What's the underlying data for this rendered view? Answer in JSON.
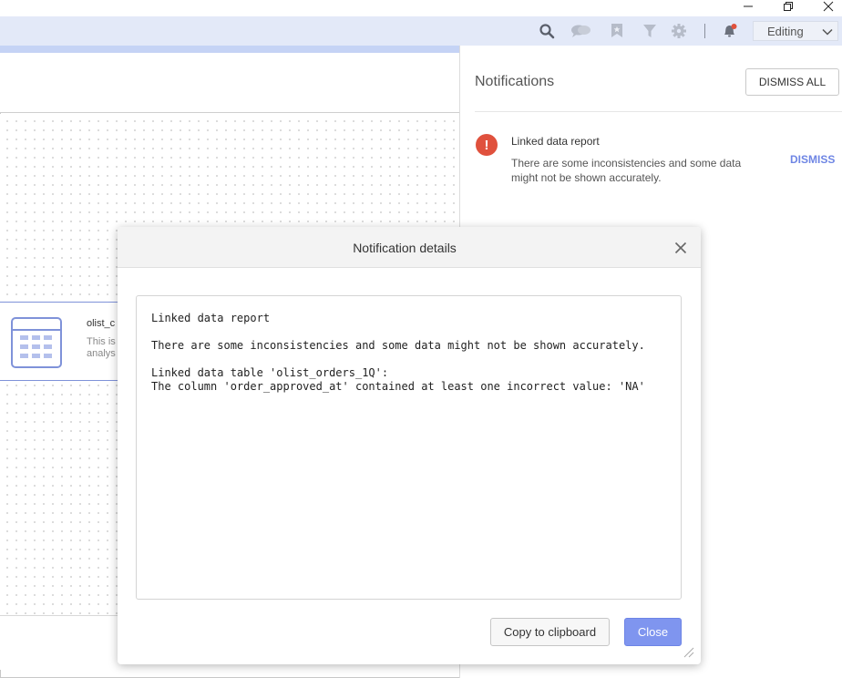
{
  "toolbar": {
    "mode_label": "Editing",
    "icons": [
      "search-icon",
      "comments-icon",
      "bookmark-icon",
      "filter-icon",
      "settings-icon",
      "notifications-bell-icon"
    ]
  },
  "canvas": {
    "card": {
      "title": "olist_c",
      "description_line1": "This is",
      "description_line2": "analys"
    }
  },
  "notifications": {
    "title": "Notifications",
    "dismiss_all_label": "DISMISS ALL",
    "items": [
      {
        "title": "Linked data report",
        "text": "There are some inconsistencies and some data might not be shown accurately.",
        "dismiss_label": "DISMISS",
        "severity_color": "#e0513d"
      }
    ]
  },
  "dialog": {
    "title": "Notification details",
    "details": {
      "line1": "Linked data report",
      "line2": "There are some inconsistencies and some data might not be shown accurately.",
      "line3": "Linked data table 'olist_orders_1Q':",
      "line4": "The column 'order_approved_at' contained at least one incorrect value: 'NA'"
    },
    "copy_label": "Copy to clipboard",
    "close_label": "Close"
  },
  "colors": {
    "toolbar_bg": "#e3e9f8",
    "accent": "#7f95ef",
    "link": "#6f86e4",
    "error": "#e0513d"
  }
}
